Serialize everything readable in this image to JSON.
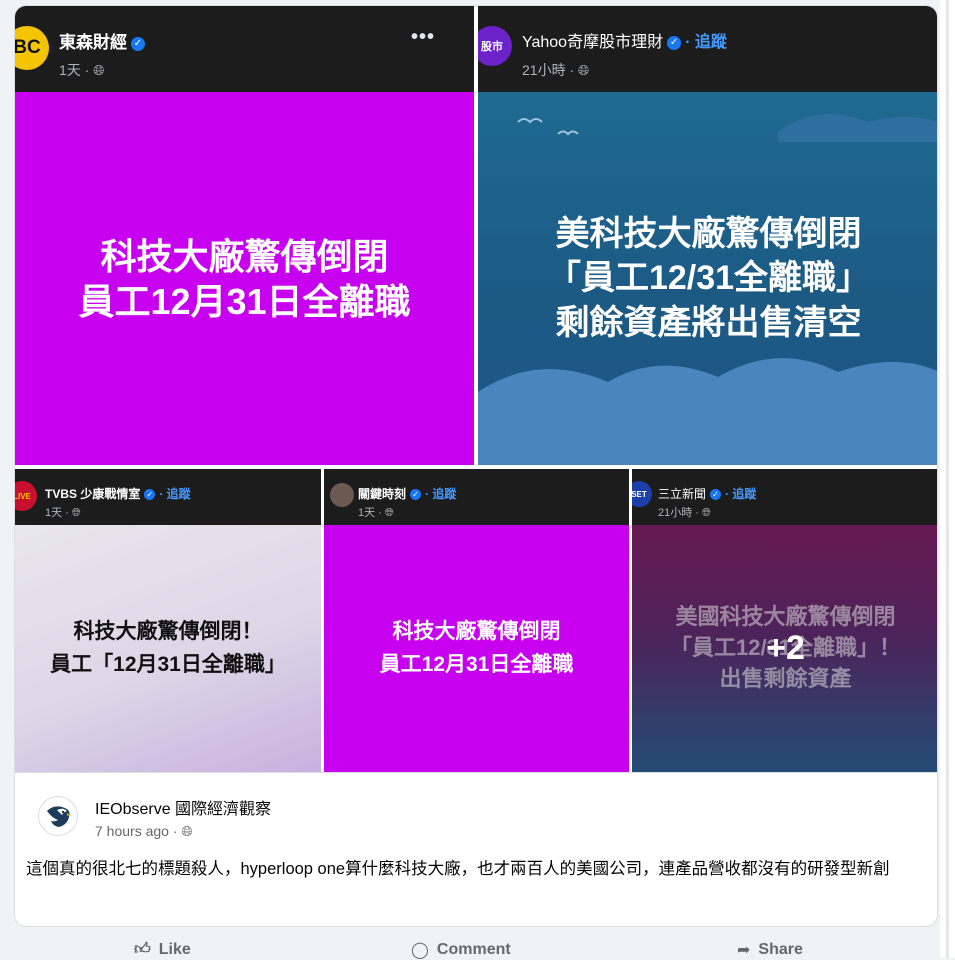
{
  "tiles": [
    {
      "source": "東森財經",
      "logo_text": "BC",
      "meta": "1天 · ",
      "headline_lines": [
        "科技大廠驚傳倒閉",
        "員工12月31日全離職"
      ],
      "menu": "•••"
    },
    {
      "source": "Yahoo奇摩股市理財",
      "meta": "21小時 · ",
      "follow": "· 追蹤",
      "headline_lines": [
        "美科技大廠驚傳倒閉",
        "「員工12/31全離職」",
        "剩餘資產將出售清空"
      ]
    },
    {
      "source": "TVBS 少康戰情室",
      "meta": "1天 · ",
      "follow": "· 追蹤",
      "headline_lines": [
        "科技大廠驚傳倒閉！",
        "員工「12月31日全離職」"
      ]
    },
    {
      "source": "關鍵時刻",
      "meta": "1天 · ",
      "follow": "· 追蹤",
      "headline_lines": [
        "科技大廠驚傳倒閉",
        "員工12月31日全離職"
      ]
    },
    {
      "source": "三立新聞",
      "meta": "21小時 · ",
      "follow": "· 追蹤",
      "headline_lines": [
        "美國科技大廠驚傳倒閉",
        "「員工12/31全離職」！",
        "出售剩餘資產"
      ]
    }
  ],
  "more_photos": "+2",
  "post": {
    "author": "IEObserve 國際經濟觀察",
    "time": "7 hours ago · ",
    "text": "這個真的很北七的標題殺人，hyperloop one算什麼科技大廠，也才兩百人的美國公司，連產品營收都沒有的研發型新創"
  },
  "actions": {
    "like": "Like",
    "comment": "Comment",
    "share": "Share"
  }
}
